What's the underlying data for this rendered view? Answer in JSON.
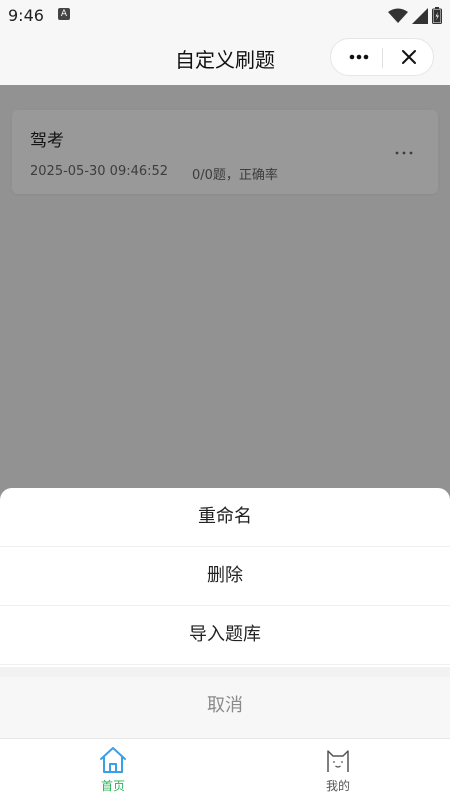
{
  "status_bar": {
    "time": "9:46",
    "notification_badge": "A",
    "icons": [
      "wifi-icon",
      "signal-icon",
      "battery-icon"
    ]
  },
  "header": {
    "title": "自定义刷题",
    "capsule_icons": [
      "more-icon",
      "close-icon"
    ]
  },
  "list": {
    "items": [
      {
        "title": "驾考",
        "date": "2025-05-30 09:46:52",
        "stats": "0/0题，正确率",
        "menu_icon": "more-icon"
      }
    ]
  },
  "action_sheet": {
    "items": [
      {
        "label": "重命名"
      },
      {
        "label": "删除"
      },
      {
        "label": "导入题库"
      }
    ],
    "cancel_label": "取消"
  },
  "tabbar": {
    "tabs": [
      {
        "label": "首页",
        "icon": "home-icon",
        "active": true,
        "color": "#2fb15a"
      },
      {
        "label": "我的",
        "icon": "cat-face-icon",
        "active": false,
        "color": "#555555"
      }
    ]
  },
  "colors": {
    "accent": "#2fb15a",
    "home_icon": "#3b9ee8",
    "overlay": "rgba(0,0,0,0.4)"
  }
}
